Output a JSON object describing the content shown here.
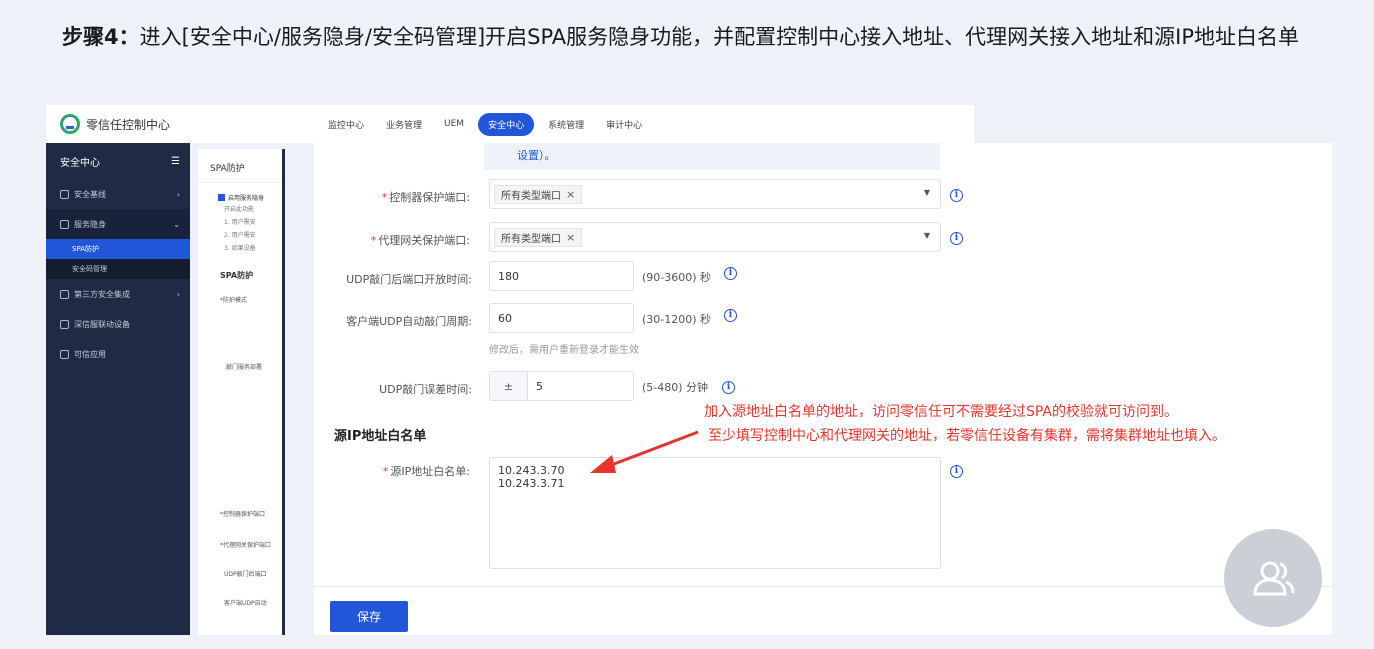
{
  "step": {
    "prefix": "步骤4：",
    "text": "进入[安全中心/服务隐身/安全码管理]开启SPA服务隐身功能，并配置控制中心接入地址、代理网关接入地址和源IP地址白名单"
  },
  "app": {
    "title": "零信任控制中心",
    "nav": [
      "监控中心",
      "业务管理",
      "UEM",
      "安全中心",
      "系统管理",
      "审计中心"
    ],
    "active_nav": "安全中心"
  },
  "sidebar": {
    "header": "安全中心",
    "items": [
      {
        "label": "安全基线"
      },
      {
        "label": "服务隐身"
      },
      {
        "label": "第三方安全集成"
      },
      {
        "label": "深信服联动设备"
      },
      {
        "label": "可信应用"
      }
    ],
    "subitems": [
      "SPA防护",
      "安全码管理"
    ]
  },
  "back_panel": {
    "tab": "SPA防护",
    "checkbox": "启用服务隐身",
    "warn_lines": [
      "开启此功能",
      "1. 用户需安",
      "2. 用户需安",
      "3. 如果设备"
    ],
    "section": "SPA防护",
    "field1": "*防护模式",
    "field2": "敲门服务部署",
    "field3": "*控制器保护端口",
    "field4": "*代理网关保护端口",
    "field5": "UDP敲门后端口",
    "field6": "客户端UDP自动"
  },
  "form": {
    "note_tail": "设置）。",
    "controller_port": {
      "label": "控制器保护端口:",
      "tag": "所有类型端口"
    },
    "gateway_port": {
      "label": "代理网关保护端口:",
      "tag": "所有类型端口"
    },
    "udp_open": {
      "label": "UDP敲门后端口开放时间:",
      "value": "180",
      "hint": "(90-3600) 秒"
    },
    "udp_period": {
      "label": "客户端UDP自动敲门周期:",
      "value": "60",
      "hint": "(30-1200) 秒",
      "subhint": "修改后，需用户重新登录才能生效"
    },
    "udp_error": {
      "label": "UDP敲门误差时间:",
      "sign": "±",
      "value": "5",
      "hint": "(5-480) 分钟"
    },
    "whitelist_section": "源IP地址白名单",
    "whitelist": {
      "label": "源IP地址白名单:",
      "lines": [
        "10.243.3.70",
        "10.243.3.71"
      ]
    },
    "save": "保存"
  },
  "annotation": {
    "line1": "加入源地址白名单的地址，访问零信任可不需要经过SPA的校验就可访问到。",
    "line2": "至少填写控制中心和代理网关的地址，若零信任设备有集群，需将集群地址也填入。"
  },
  "colors": {
    "accent": "#2156d9",
    "sidebar": "#1f2a44",
    "annotation": "#e5352d",
    "required": "#e0393e"
  }
}
